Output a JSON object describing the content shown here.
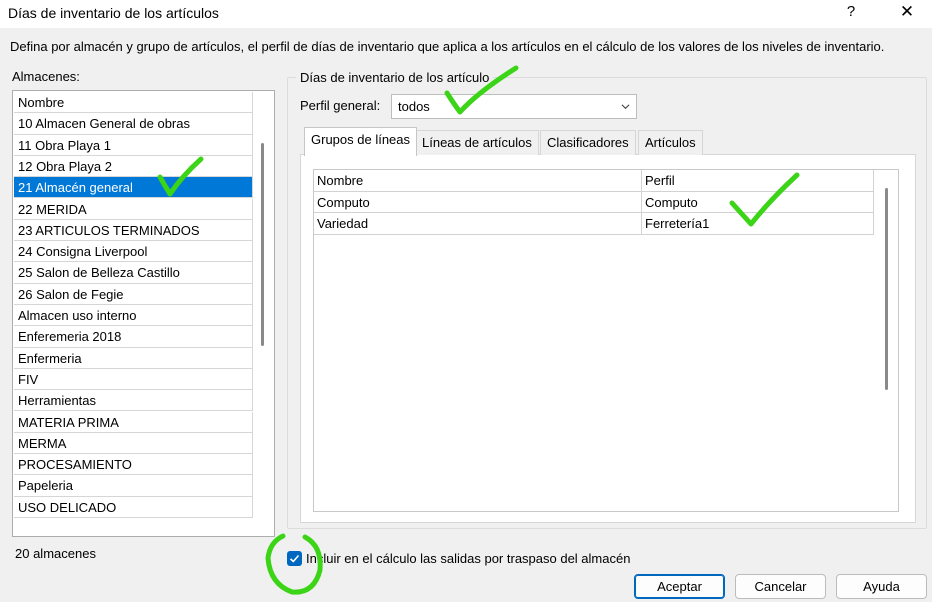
{
  "window": {
    "title": "Días de inventario de los artículos",
    "help_label": "?",
    "close_label": "✕"
  },
  "description": "Defina por almacén y grupo de artículos, el perfil de días de inventario que aplica a los artículos en el cálculo de los valores de los niveles de inventario.",
  "warehouses": {
    "label": "Almacenes:",
    "header": "Nombre",
    "items": [
      "10 Almacen General de obras",
      "11 Obra Playa 1",
      "12 Obra Playa 2",
      "21 Almacén general",
      "22 MERIDA",
      "23 ARTICULOS TERMINADOS",
      "24 Consigna Liverpool",
      "25 Salon de Belleza Castillo",
      "26 Salon de Fegie",
      "Almacen uso interno",
      "Enferemeria 2018",
      "Enfermeria",
      "FIV",
      "Herramientas",
      "MATERIA PRIMA",
      "MERMA",
      "PROCESAMIENTO",
      "Papeleria",
      "USO DELICADO"
    ],
    "selected": "21 Almacén general",
    "count_text": "20 almacenes"
  },
  "inventory_days": {
    "group_title": "Días de inventario de los artículo",
    "profile_label": "Perfil general:",
    "profile_value": "todos",
    "tabs": [
      "Grupos de líneas",
      "Líneas de artículos",
      "Clasificadores",
      "Artículos"
    ],
    "active_tab": "Grupos de líneas",
    "grid": {
      "columns": [
        "Nombre",
        "Perfil"
      ],
      "rows": [
        [
          "Computo",
          "Computo"
        ],
        [
          "Variedad",
          "Ferretería1"
        ]
      ]
    }
  },
  "include_transfers": {
    "checked": true,
    "label": "Incluir en el cálculo las salidas por traspaso del almacén"
  },
  "buttons": {
    "accept": "Aceptar",
    "cancel": "Cancelar",
    "help": "Ayuda"
  },
  "colors": {
    "selection": "#0078d7",
    "checkbox": "#0067c0",
    "annotation_marker": "#3bd416"
  },
  "icons": {
    "combo_arrow": "chevron-down-icon",
    "checkbox": "check-icon",
    "annotations": "green-checkmark-annotation"
  }
}
